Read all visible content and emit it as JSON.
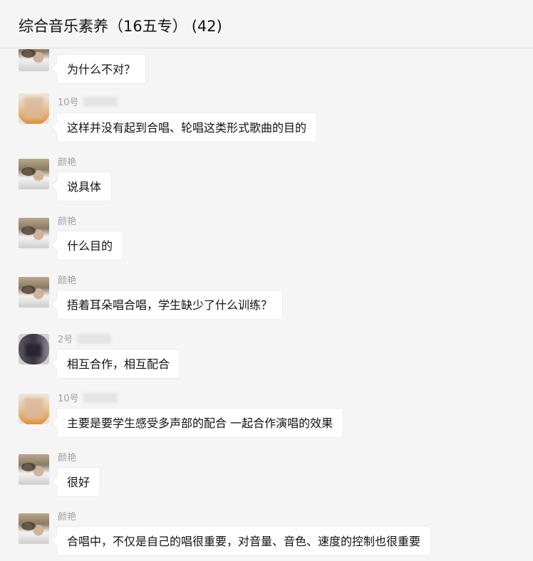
{
  "header": {
    "title": "综合音乐素养（16五专）",
    "member_count": "(42)"
  },
  "messages": [
    {
      "sender": "",
      "avatar": "yanyan-avatar",
      "text": "为什么不对？"
    },
    {
      "sender": "10号",
      "avatar": "no10-avatar",
      "text": "这样并没有起到合唱、轮唱这类形式歌曲的目的"
    },
    {
      "sender": "颜艳",
      "avatar": "yanyan-avatar",
      "text": "说具体"
    },
    {
      "sender": "颜艳",
      "avatar": "yanyan-avatar",
      "text": "什么目的"
    },
    {
      "sender": "颜艳",
      "avatar": "yanyan-avatar",
      "text": "捂着耳朵唱合唱，学生缺少了什么训练？"
    },
    {
      "sender": "2号",
      "avatar": "no2-avatar",
      "text": "相互合作，相互配合"
    },
    {
      "sender": "10号",
      "avatar": "no10-avatar",
      "text": "主要是要学生感受多声部的配合   一起合作演唱的效果"
    },
    {
      "sender": "颜艳",
      "avatar": "yanyan-avatar",
      "text": "很好"
    },
    {
      "sender": "颜艳",
      "avatar": "yanyan-avatar",
      "text": "合唱中，不仅是自己的唱很重要，对音量、音色、速度的控制也很重要"
    }
  ]
}
